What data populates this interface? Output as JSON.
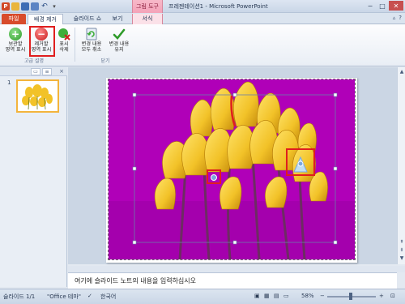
{
  "app": {
    "title": "프레젠테이션1 - Microsoft PowerPoint",
    "context_tab_group": "그림 도구"
  },
  "quick_access": {
    "logo": "P",
    "undo": "↶",
    "more": "▾"
  },
  "window_controls": {
    "minimize": "−",
    "maximize": "□",
    "close": "✕"
  },
  "tabs": {
    "file": "파일",
    "background_removal": "배경 제거",
    "slide_show": "슬라이드 쇼",
    "view": "보기",
    "format": "서식"
  },
  "ribbon_right": {
    "help": "?",
    "minimize": "▵"
  },
  "ribbon": {
    "mark_keep": "보관할\n영역 표시",
    "mark_remove": "제거할\n영역 표시",
    "delete_mark": "표시\n삭제",
    "discard_changes": "변경 내용\n모두 취소",
    "keep_changes": "변경 내용\n유지",
    "group_refine": "고급 설명",
    "group_close": "닫기"
  },
  "left_pane": {
    "slide_number": "1",
    "close": "×"
  },
  "notes": {
    "placeholder": "여기에 슬라이드 노트의 내용을 입력하십시오"
  },
  "status_bar": {
    "slide_info": "슬라이드 1/1",
    "theme": "\"Office 테마\"",
    "language": "한국어",
    "zoom": "58%",
    "zoom_minus": "−",
    "zoom_plus": "+"
  },
  "colors": {
    "removal_magenta": "#b000b8",
    "tulip_yellow": "#f2c228",
    "highlight_red": "#e01e1e",
    "file_tab": "#d84b2b"
  }
}
